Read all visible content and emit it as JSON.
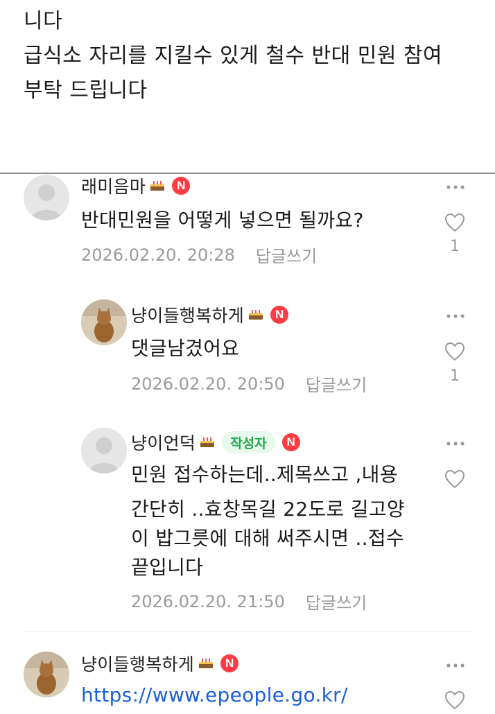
{
  "post": {
    "lines": [
      "니다",
      "급식소 자리를 지킬수 있게 철수 반대 민원 참여",
      "부탁 드립니다"
    ]
  },
  "comments": [
    {
      "nickname": "래미음마",
      "avatar": "default-avatar",
      "text": [
        "반대민원을 어떻게 넣으면 될까요?"
      ],
      "date": "2026.02.20. 20:28",
      "reply_label": "답글쓰기",
      "likes": "1"
    },
    {
      "nickname": "냥이들행복하게",
      "avatar": "cat-avatar",
      "text": [
        "댓글남겼어요"
      ],
      "date": "2026.02.20. 20:50",
      "reply_label": "답글쓰기",
      "likes": "1"
    },
    {
      "nickname": "냥이언덕",
      "avatar": "default-avatar",
      "author_badge": "작성자",
      "text": [
        "민원 접수하는데..제목쓰고 ,내용",
        "간단히 ..효창목길 22도로 길고양",
        "이 밥그릇에 대해 써주시면 ..접수",
        "끝입니다"
      ],
      "date": "2026.02.20. 21:50",
      "reply_label": "답글쓰기",
      "likes": ""
    },
    {
      "nickname": "냥이들행복하게",
      "avatar": "cat-avatar",
      "link": "https://www.epeople.go.kr/"
    }
  ],
  "badges": {
    "new_badge": "N"
  },
  "icons": {
    "cake": "cake-icon",
    "more": "more-icon",
    "heart": "heart-outline-icon"
  },
  "colors": {
    "new_badge": "#ff3b44",
    "author_badge_bg": "#e8f8ec",
    "author_badge_text": "#1fa94a",
    "link": "#1a5fd6",
    "meta_text": "#9a9a9a"
  }
}
